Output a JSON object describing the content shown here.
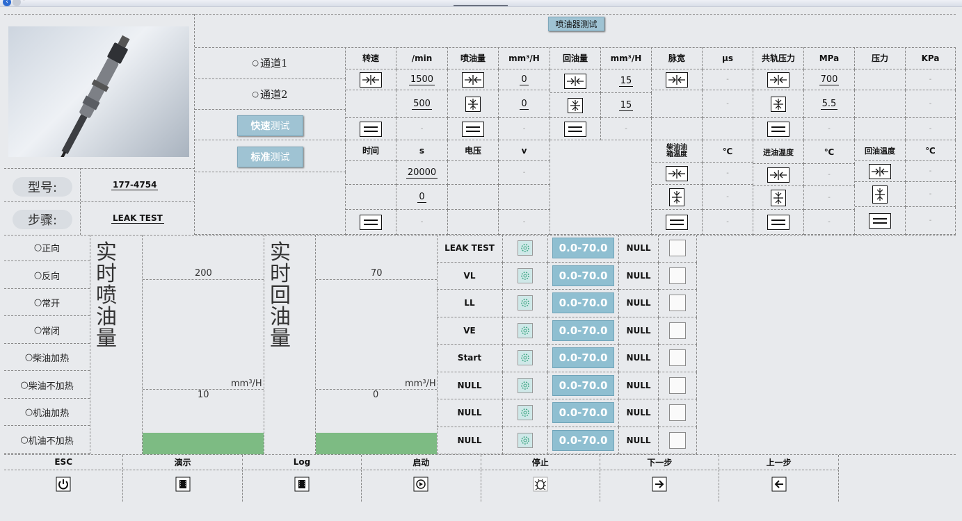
{
  "window": {
    "title": "喷油器测试"
  },
  "channels": {
    "ch1": "通道1",
    "ch2": "通道2"
  },
  "buttons": {
    "quick_a": "快速",
    "quick_b": "测试",
    "std_a": "标准",
    "std_b": "测试"
  },
  "info": {
    "model_label": "型号:",
    "model_value": "177-4754",
    "step_label": "步骤:",
    "step_value": "LEAK TEST"
  },
  "headers": {
    "speed": "转速",
    "speed_unit": "/min",
    "inject": "喷油量",
    "inject_unit": "mm³/H",
    "ret": "回油量",
    "ret_unit": "mm³/H",
    "pulse": "脉宽",
    "pulse_unit": "μs",
    "rail": "共轨压力",
    "rail_unit": "MPa",
    "press": "压力",
    "press_unit": "KPa",
    "time": "时间",
    "time_unit": "s",
    "volt": "电压",
    "volt_unit": "v",
    "tank_a": "柴油油",
    "tank_b": "箱温度",
    "tank_unit": "℃",
    "inlet": "进油温度",
    "inlet_unit": "℃",
    "retemp": "回油温度",
    "retemp_unit": "℃"
  },
  "values": {
    "speed1": "1500",
    "speed2": "500",
    "inject1": "0",
    "inject2": "0",
    "ret1": "15",
    "ret2": "15",
    "rail1": "700",
    "rail2": "5.5",
    "time1": "20000",
    "time2": "0",
    "dash": "-"
  },
  "modes": [
    "正向",
    "反向",
    "常开",
    "常闭",
    "柴油加热",
    "柴油不加热",
    "机油加热",
    "机油不加热"
  ],
  "gauges": {
    "inject_title": [
      "实",
      "时",
      "喷",
      "油",
      "量"
    ],
    "inject_max": "200",
    "inject_min": "10",
    "inject_unit": "mm³/H",
    "ret_title": [
      "实",
      "时",
      "回",
      "油",
      "量"
    ],
    "ret_max": "70",
    "ret_min": "0",
    "ret_unit": "mm³/H",
    "inject_level": 0.0,
    "ret_level": 0.0
  },
  "steps": [
    {
      "name": "LEAK TEST",
      "range": "0.0-70.0",
      "result": "NULL"
    },
    {
      "name": "VL",
      "range": "0.0-70.0",
      "result": "NULL"
    },
    {
      "name": "LL",
      "range": "0.0-70.0",
      "result": "NULL"
    },
    {
      "name": "VE",
      "range": "0.0-70.0",
      "result": "NULL"
    },
    {
      "name": "Start",
      "range": "0.0-70.0",
      "result": "NULL"
    },
    {
      "name": "NULL",
      "range": "0.0-70.0",
      "result": "NULL"
    },
    {
      "name": "NULL",
      "range": "0.0-70.0",
      "result": "NULL"
    },
    {
      "name": "NULL",
      "range": "0.0-70.0",
      "result": "NULL"
    }
  ],
  "bottom": [
    {
      "label": "ESC",
      "icon": "power-icon"
    },
    {
      "label": "演示",
      "icon": "film-icon"
    },
    {
      "label": "Log",
      "icon": "film-icon"
    },
    {
      "label": "启动",
      "icon": "play-icon"
    },
    {
      "label": "停止",
      "icon": "bug-icon"
    },
    {
      "label": "下一步",
      "icon": "arrow-right-icon"
    },
    {
      "label": "上一步",
      "icon": "arrow-left-icon"
    }
  ]
}
